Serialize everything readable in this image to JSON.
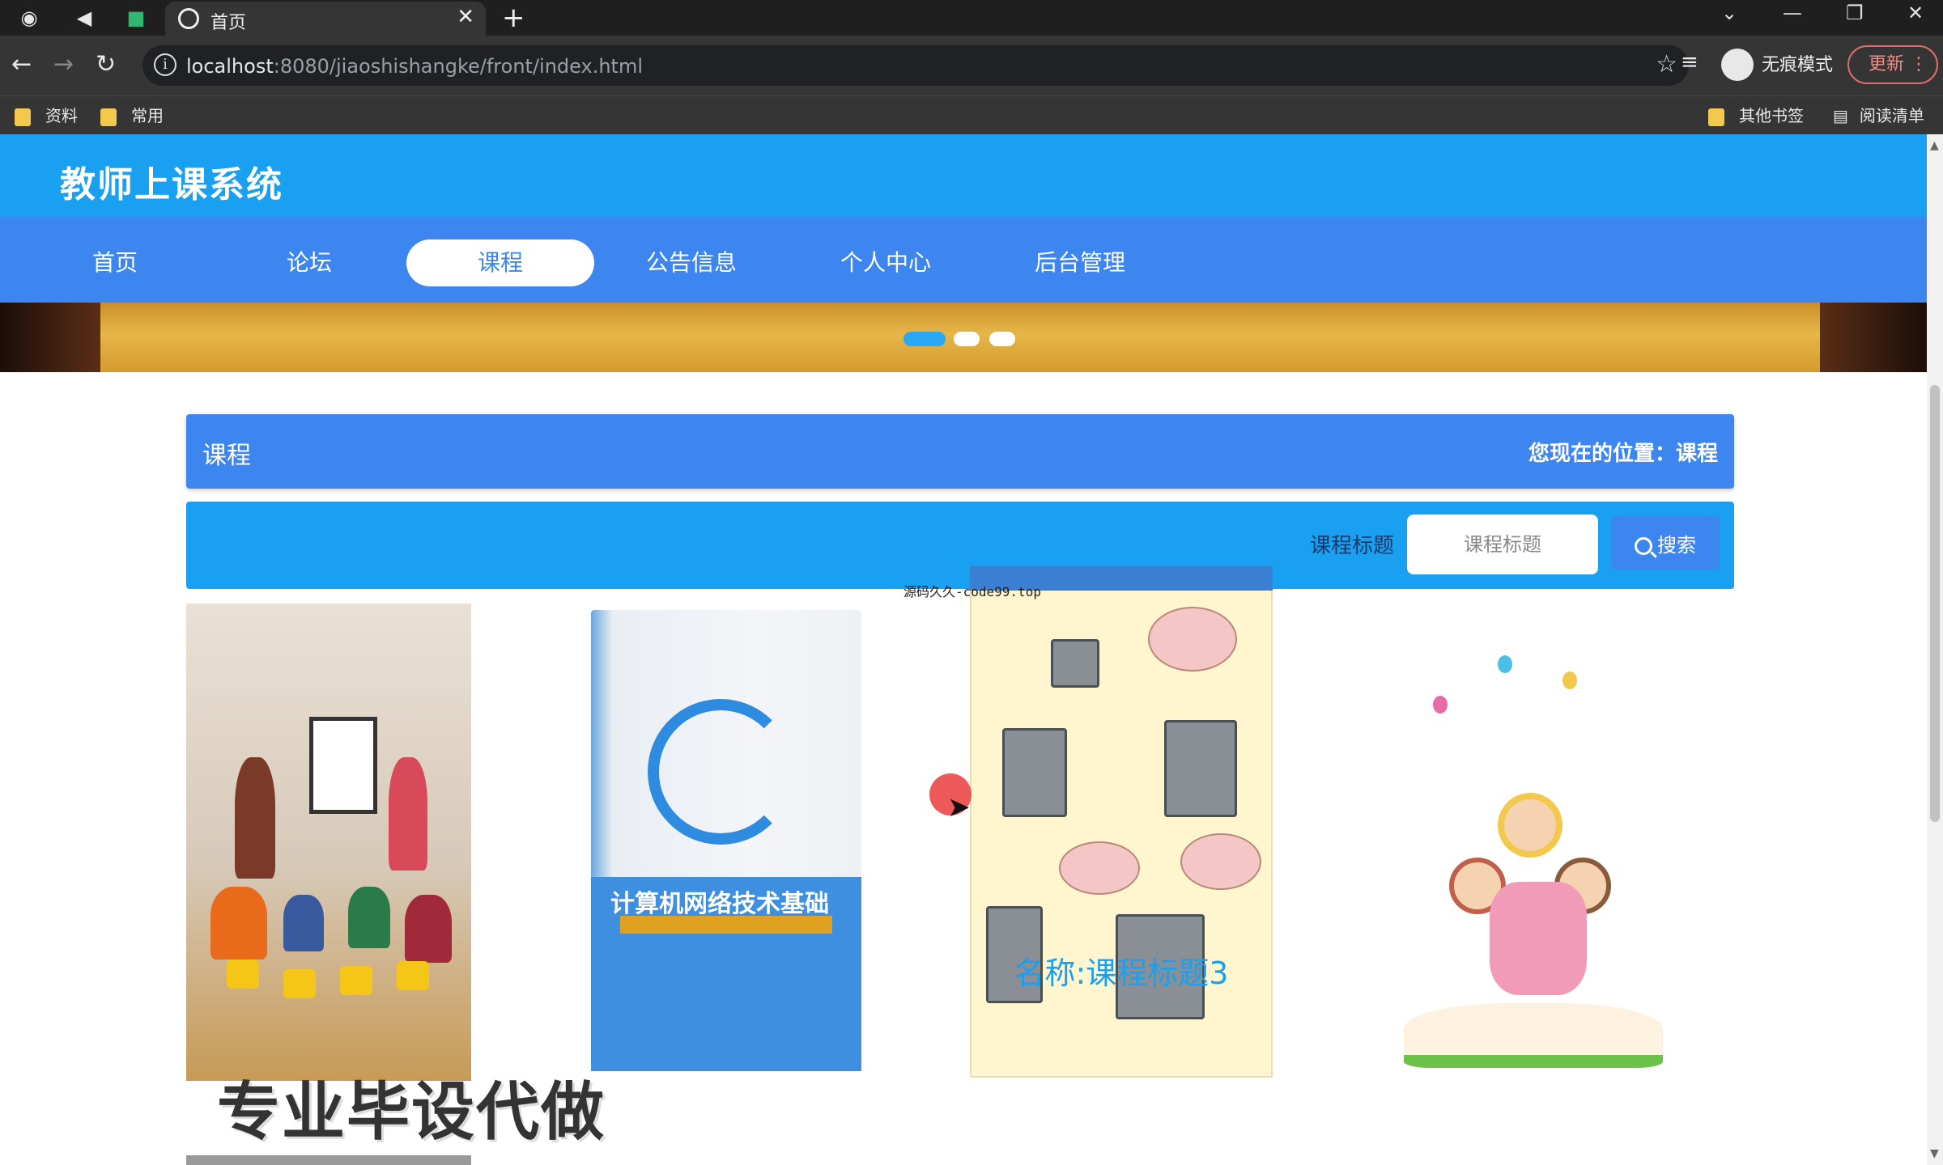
{
  "browser": {
    "tab_title": "首页",
    "url_host": "localhost",
    "url_path": ":8080/jiaoshishangke/front/index.html",
    "incognito_label": "无痕模式",
    "update_label": "更新",
    "bookmarks": [
      "资料",
      "常用"
    ],
    "other_bookmarks": "其他书签",
    "reading_list": "阅读清单"
  },
  "site": {
    "title": "教师上课系统",
    "nav": [
      "首页",
      "论坛",
      "课程",
      "公告信息",
      "个人中心",
      "后台管理"
    ],
    "active_nav_index": 2
  },
  "section": {
    "title": "课程",
    "breadcrumb": "您现在的位置：课程"
  },
  "search": {
    "label": "课程标题",
    "placeholder": "课程标题",
    "button_label": "搜索"
  },
  "cards": {
    "book_cover_title": "计算机网络技术基础",
    "caption": "名称:课程标题3"
  },
  "overlays": {
    "watermark_text": "源码久久-code99.top",
    "ad_text": "专业毕设代做"
  },
  "colors": {
    "header_blue": "#1aa0f0",
    "nav_blue": "#3d86f0"
  }
}
